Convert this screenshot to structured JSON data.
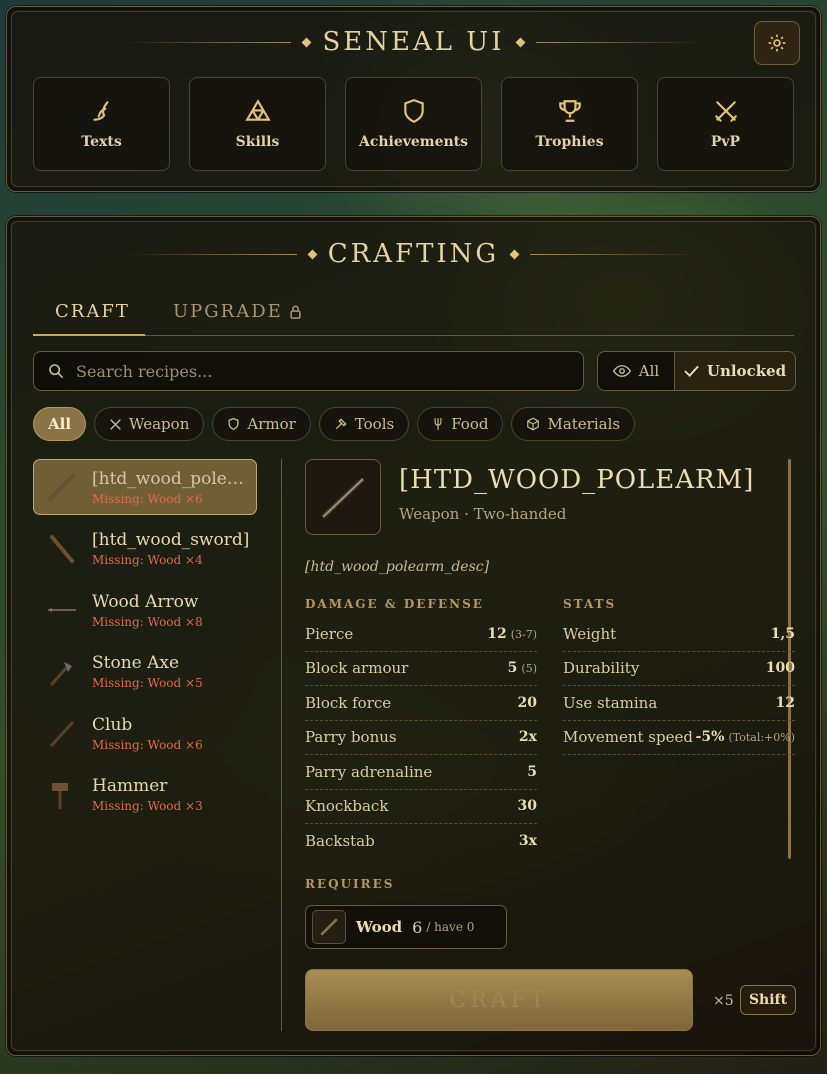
{
  "header": {
    "title": "SENEAL UI",
    "settings_icon": "gear-icon"
  },
  "nav": [
    {
      "label": "Texts",
      "icon": "quill-icon"
    },
    {
      "label": "Skills",
      "icon": "triforce-icon"
    },
    {
      "label": "Achievements",
      "icon": "shield-icon"
    },
    {
      "label": "Trophies",
      "icon": "trophy-icon"
    },
    {
      "label": "PvP",
      "icon": "crossed-swords-icon"
    }
  ],
  "crafting": {
    "title": "CRAFTING",
    "tabs": [
      {
        "label": "CRAFT",
        "active": true
      },
      {
        "label": "UPGRADE",
        "locked": true
      }
    ],
    "search": {
      "placeholder": "Search recipes...",
      "value": ""
    },
    "filter": {
      "all": "All",
      "unlocked": "Unlocked",
      "selected": "Unlocked"
    },
    "chips": [
      {
        "label": "All",
        "active": true
      },
      {
        "label": "Weapon"
      },
      {
        "label": "Armor"
      },
      {
        "label": "Tools"
      },
      {
        "label": "Food"
      },
      {
        "label": "Materials"
      }
    ],
    "recipes": [
      {
        "name": "[htd_wood_polea...",
        "missing": "Missing: Wood ×6",
        "selected": true
      },
      {
        "name": "[htd_wood_sword]",
        "missing": "Missing: Wood ×4"
      },
      {
        "name": "Wood Arrow",
        "missing": "Missing: Wood ×8"
      },
      {
        "name": "Stone Axe",
        "missing": "Missing: Wood ×5"
      },
      {
        "name": "Club",
        "missing": "Missing: Wood ×6"
      },
      {
        "name": "Hammer",
        "missing": "Missing: Wood ×3"
      }
    ],
    "detail": {
      "name": "[HTD_WOOD_POLEARM]",
      "subtitle": "Weapon · Two-handed",
      "description": "[htd_wood_polearm_desc]",
      "damage_header": "DAMAGE & DEFENSE",
      "stats_header": "STATS",
      "damage": [
        {
          "label": "Pierce",
          "value": "12",
          "extra": "(3-7)"
        },
        {
          "label": "Block armour",
          "value": "5",
          "extra": "(5)"
        },
        {
          "label": "Block force",
          "value": "20",
          "extra": ""
        },
        {
          "label": "Parry bonus",
          "value": "2x",
          "extra": ""
        },
        {
          "label": "Parry adrenaline",
          "value": "5",
          "extra": ""
        },
        {
          "label": "Knockback",
          "value": "30",
          "extra": ""
        },
        {
          "label": "Backstab",
          "value": "3x",
          "extra": ""
        }
      ],
      "stats": [
        {
          "label": "Weight",
          "value": "1,5",
          "extra": ""
        },
        {
          "label": "Durability",
          "value": "100",
          "extra": ""
        },
        {
          "label": "Use stamina",
          "value": "12",
          "extra": ""
        },
        {
          "label": "Movement speed",
          "value": "-5%",
          "extra": "(Total:+0%)"
        }
      ],
      "requires_header": "REQUIRES",
      "requires": {
        "name": "Wood",
        "qty": "6",
        "have": "/ have 0"
      }
    },
    "craft_button": "CRAFT",
    "multiplier": "×5",
    "shift_label": "Shift"
  },
  "colors": {
    "accent": "#c9a864",
    "missing": "#e06a4a",
    "panel": "#18120a"
  }
}
